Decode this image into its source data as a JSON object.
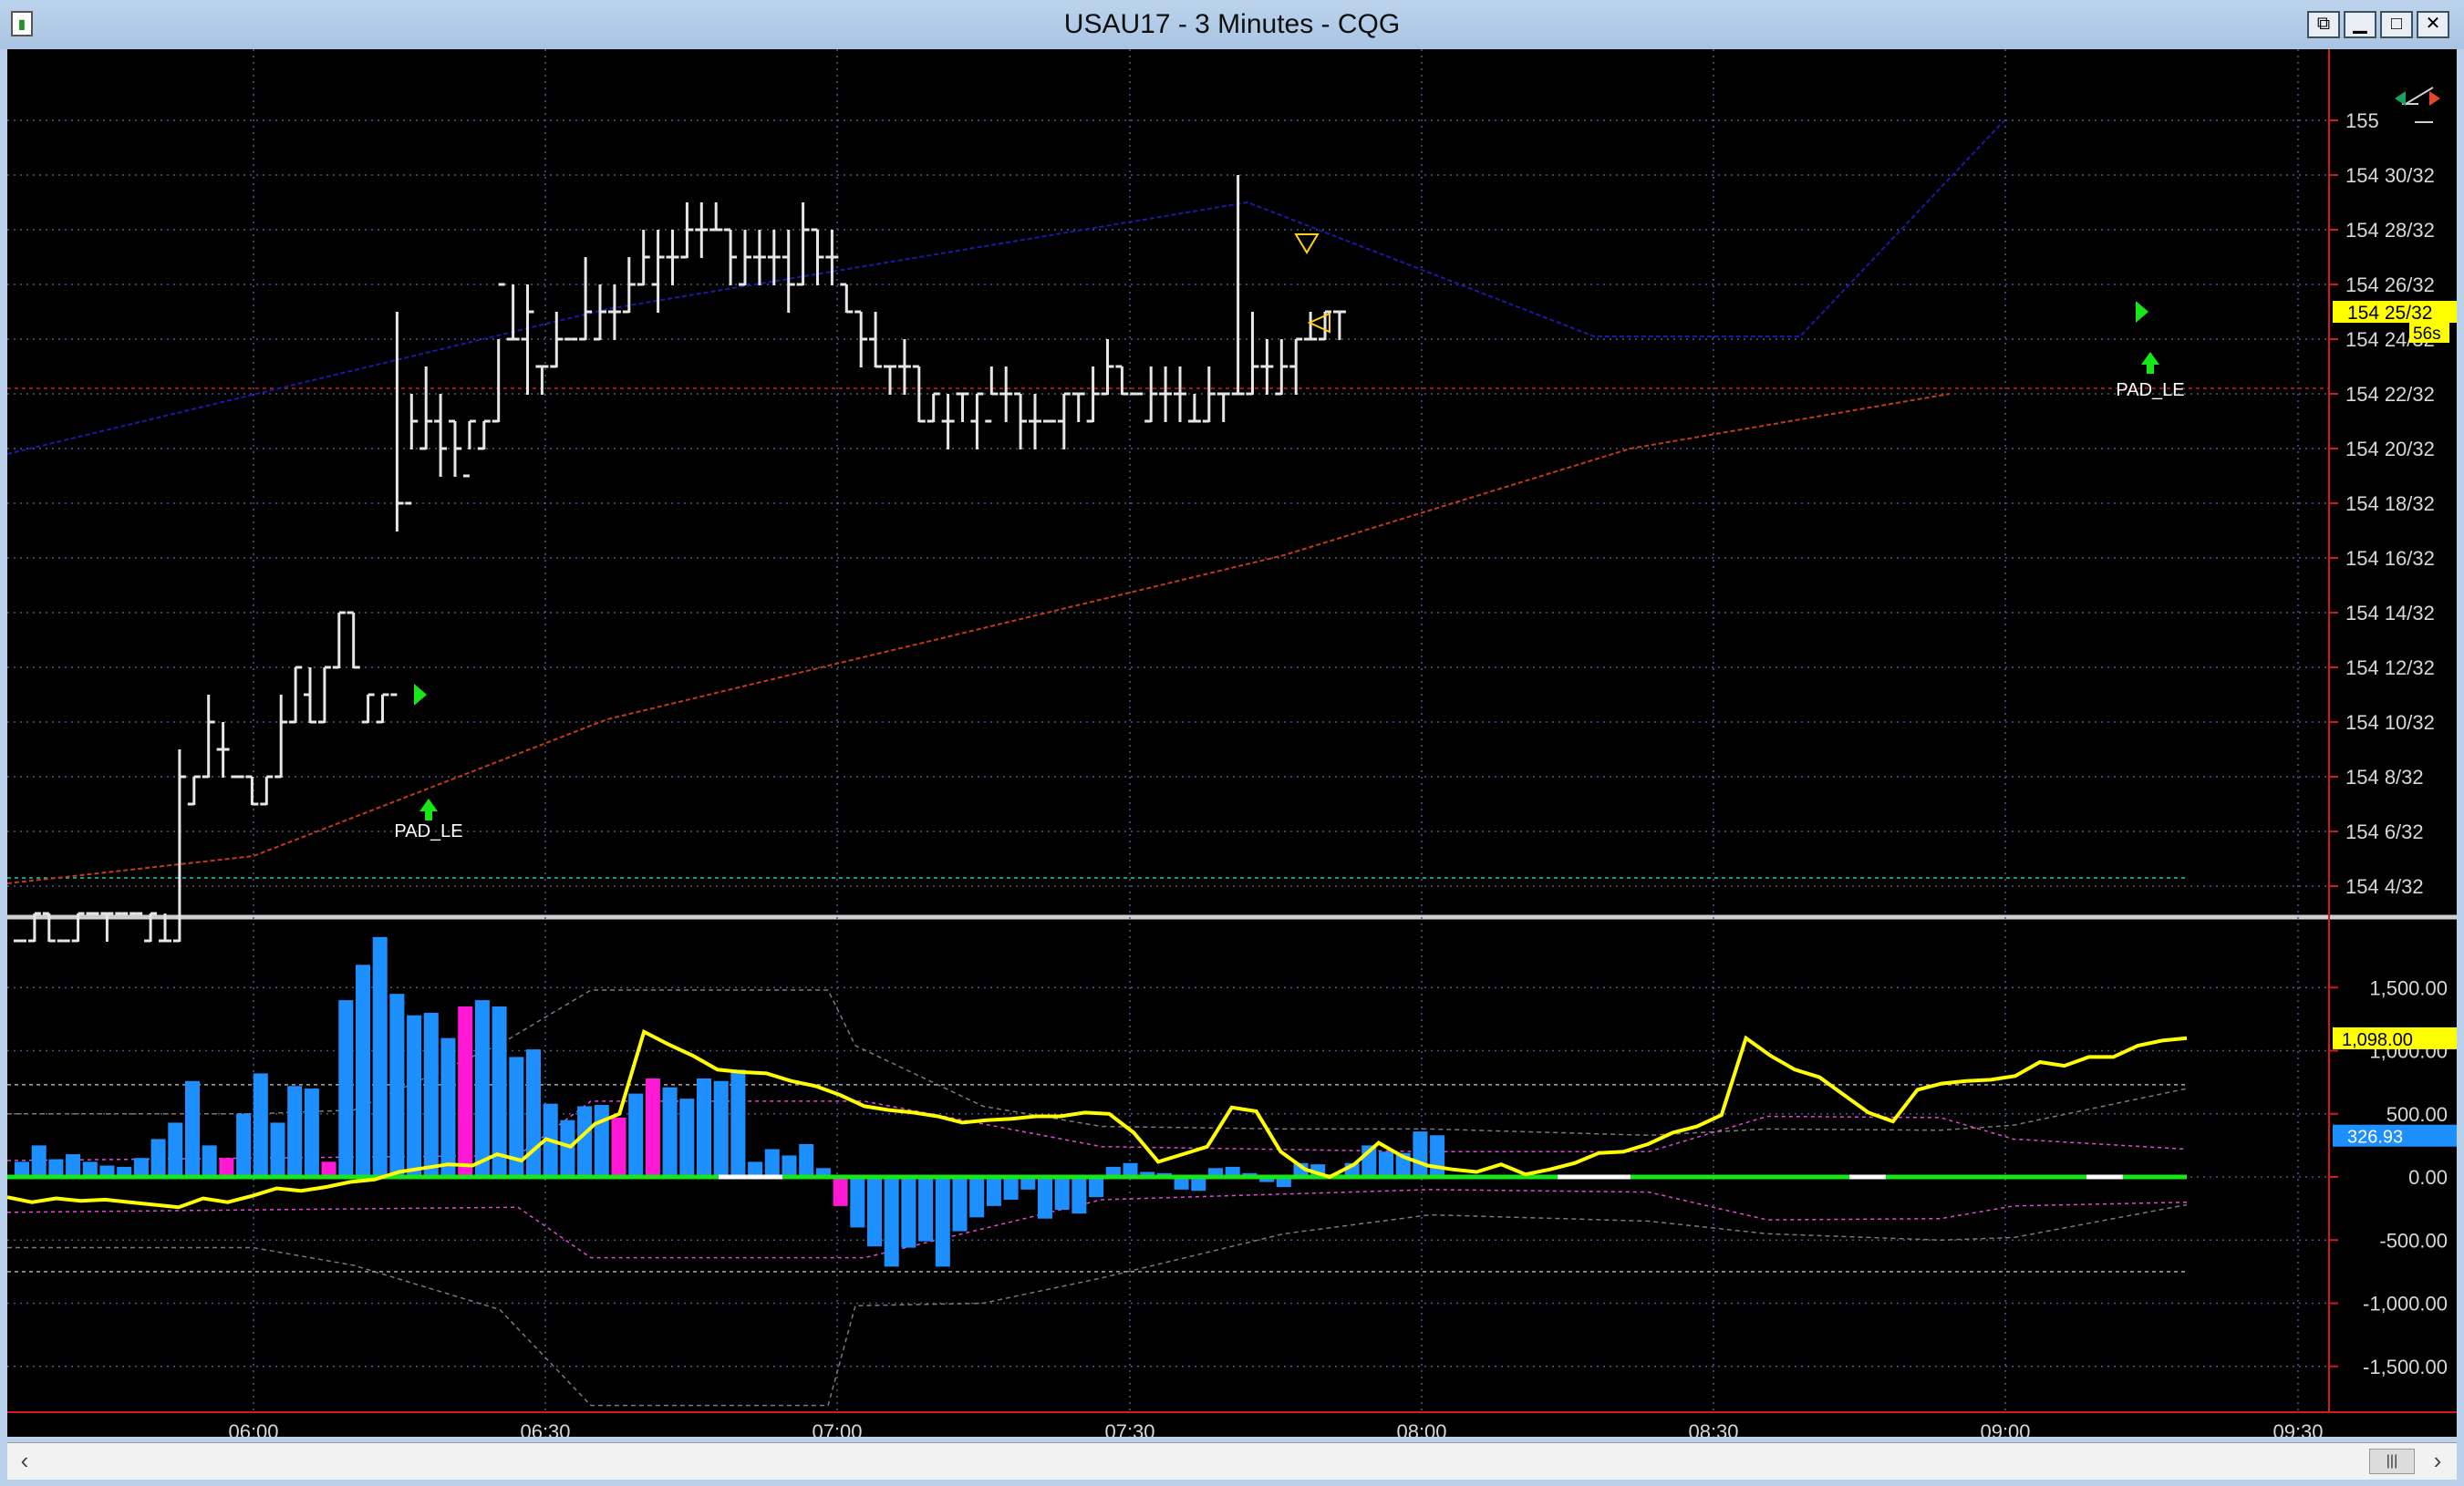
{
  "window": {
    "title": "USAU17 - 3 Minutes - CQG",
    "buttons": [
      "restore-icon",
      "minimize-icon",
      "maximize-icon",
      "close-icon"
    ]
  },
  "price_axis": {
    "labels": [
      "155",
      "154 30/32",
      "154 28/32",
      "154 26/32",
      "154 24/32",
      "154 22/32",
      "154 20/32",
      "154 18/32",
      "154 16/32",
      "154 14/32",
      "154 12/32",
      "154 10/32",
      "154 8/32",
      "154 6/32",
      "154 4/32"
    ],
    "current_price": "154 25/32",
    "countdown": "56s"
  },
  "indicator_axis": {
    "labels": [
      "1,500.00",
      "1,000.00",
      "500.00",
      "0.00",
      "-500.00",
      "-1,000.00",
      "-1,500.00"
    ],
    "line_value": "1,098.00",
    "hist_value": "326.93"
  },
  "time_axis": {
    "labels": [
      "06:00",
      "06:30",
      "07:00",
      "07:30",
      "08:00",
      "08:30",
      "09:00",
      "09:30"
    ]
  },
  "signals": {
    "long_entry_1": "PAD_LE",
    "long_entry_2": "PAD_LE"
  },
  "colors": {
    "background": "#000000",
    "bars": "#e6e6e6",
    "histogram_blue": "#1e8fff",
    "histogram_magenta": "#ff19d4",
    "oscillator_line": "#ffff00",
    "upper_band": "#1a1aa8",
    "lower_band": "#c23a1a",
    "price_tag": "#ffff00",
    "grid_red": "#d11a1a",
    "entry_arrow": "#19e619"
  },
  "chart_data": {
    "type": "bar",
    "title": "",
    "bars_ticks_32nds": [
      [
        2,
        2,
        2,
        2
      ],
      [
        2,
        3,
        2,
        3
      ],
      [
        3,
        3,
        2,
        2
      ],
      [
        2,
        2,
        2,
        2
      ],
      [
        2,
        3,
        2,
        3
      ],
      [
        3,
        3,
        3,
        3
      ],
      [
        3,
        3,
        2,
        3
      ],
      [
        3,
        3,
        3,
        3
      ],
      [
        3,
        3,
        3,
        3
      ],
      [
        2,
        3,
        2,
        3
      ],
      [
        2,
        3,
        2,
        2
      ],
      [
        2,
        9,
        2,
        8
      ],
      [
        7,
        8,
        7,
        8
      ],
      [
        8,
        11,
        8,
        10
      ],
      [
        9,
        10,
        8,
        9
      ],
      [
        8,
        8,
        8,
        8
      ],
      [
        8,
        8,
        7,
        7
      ],
      [
        7,
        8,
        7,
        8
      ],
      [
        8,
        11,
        8,
        10
      ],
      [
        10,
        12,
        10,
        12
      ],
      [
        11,
        12,
        10,
        10
      ],
      [
        10,
        12,
        10,
        12
      ],
      [
        12,
        14,
        12,
        14
      ],
      [
        14,
        14,
        12,
        12
      ],
      [
        10,
        11,
        10,
        11
      ],
      [
        10,
        11,
        10,
        11
      ],
      [
        11,
        25,
        17,
        18
      ],
      [
        18,
        22,
        20,
        21
      ],
      [
        20,
        23,
        20,
        21
      ],
      [
        21,
        22,
        19,
        20
      ],
      [
        21,
        21,
        19,
        20
      ],
      [
        19,
        21,
        20,
        21
      ],
      [
        20,
        21,
        20,
        21
      ],
      [
        21,
        24,
        21,
        26
      ],
      [
        24,
        26,
        24,
        24
      ],
      [
        24,
        26,
        22,
        25
      ],
      [
        23,
        23,
        22,
        23
      ],
      [
        23,
        25,
        23,
        24
      ],
      [
        24,
        24,
        24,
        24
      ],
      [
        24,
        27,
        24,
        25
      ],
      [
        24,
        26,
        24,
        25
      ],
      [
        25,
        26,
        24,
        25
      ],
      [
        25,
        27,
        25,
        26
      ],
      [
        26,
        28,
        26,
        27
      ],
      [
        26,
        28,
        25,
        27
      ],
      [
        27,
        28,
        26,
        27
      ],
      [
        27,
        29,
        27,
        28
      ],
      [
        28,
        29,
        27,
        28
      ],
      [
        28,
        29,
        28,
        28
      ],
      [
        28,
        28,
        26,
        27
      ],
      [
        26,
        28,
        26,
        27
      ],
      [
        27,
        28,
        26,
        27
      ],
      [
        27,
        28,
        26,
        27
      ],
      [
        27,
        28,
        25,
        26
      ],
      [
        26,
        29,
        26,
        28
      ],
      [
        28,
        28,
        26,
        27
      ],
      [
        27,
        28,
        26,
        27
      ],
      [
        26,
        26,
        25,
        25
      ],
      [
        25,
        25,
        23,
        24
      ],
      [
        24,
        25,
        23,
        23
      ],
      [
        23,
        23,
        22,
        23
      ],
      [
        23,
        24,
        22,
        23
      ],
      [
        23,
        23,
        21,
        21
      ],
      [
        21,
        22,
        21,
        22
      ],
      [
        21,
        22,
        20,
        21
      ],
      [
        22,
        22,
        21,
        22
      ],
      [
        21,
        22,
        20,
        22
      ],
      [
        21,
        23,
        22,
        22
      ],
      [
        22,
        23,
        21,
        22
      ],
      [
        22,
        22,
        20,
        21
      ],
      [
        21,
        22,
        20,
        21
      ],
      [
        21,
        21,
        21,
        21
      ],
      [
        21,
        22,
        20,
        22
      ],
      [
        22,
        22,
        21,
        22
      ],
      [
        21,
        23,
        21,
        22
      ],
      [
        22,
        24,
        22,
        23
      ],
      [
        23,
        23,
        22,
        22
      ],
      [
        22,
        22,
        22,
        22
      ],
      [
        21,
        23,
        21,
        22
      ],
      [
        22,
        23,
        21,
        22
      ],
      [
        22,
        23,
        21,
        22
      ],
      [
        21,
        22,
        21,
        21
      ],
      [
        21,
        23,
        21,
        22
      ],
      [
        22,
        22,
        21,
        22
      ],
      [
        22,
        30,
        22,
        22
      ],
      [
        22,
        25,
        22,
        23
      ],
      [
        23,
        24,
        22,
        23
      ],
      [
        22,
        24,
        22,
        23
      ],
      [
        23,
        24,
        22,
        24
      ],
      [
        24,
        25,
        24,
        24
      ],
      [
        24,
        25,
        24,
        25
      ],
      [
        25,
        25,
        24,
        25
      ]
    ],
    "histogram": [
      120,
      250,
      140,
      180,
      120,
      90,
      80,
      150,
      300,
      430,
      760,
      250,
      150,
      500,
      820,
      430,
      720,
      700,
      120,
      1400,
      1680,
      1900,
      1450,
      1280,
      1300,
      1100,
      1350,
      1400,
      1350,
      950,
      1010,
      580,
      450,
      560,
      570,
      470,
      660,
      780,
      710,
      620,
      780,
      760,
      850,
      120,
      220,
      170,
      260,
      70,
      -230,
      -400,
      -550,
      -710,
      -560,
      -510,
      -710,
      -430,
      -320,
      -230,
      -180,
      -100,
      -330,
      -260,
      -290,
      -160,
      80,
      110,
      40,
      30,
      -100,
      -110,
      70,
      80,
      30,
      -40,
      -80,
      110,
      100,
      20,
      110,
      250,
      200,
      190,
      360,
      330
    ],
    "oscillator": [
      -160,
      -200,
      -170,
      -190,
      -180,
      -200,
      -220,
      -240,
      -170,
      -200,
      -150,
      -90,
      -110,
      -80,
      -40,
      -20,
      40,
      70,
      100,
      90,
      180,
      130,
      300,
      240,
      420,
      500,
      1150,
      1050,
      960,
      850,
      830,
      820,
      760,
      720,
      650,
      560,
      530,
      510,
      480,
      430,
      450,
      460,
      480,
      480,
      510,
      500,
      350,
      120,
      180,
      240,
      550,
      520,
      200,
      60,
      0,
      100,
      270,
      160,
      90,
      60,
      40,
      100,
      20,
      60,
      110,
      190,
      200,
      260,
      350,
      400,
      490,
      1100,
      960,
      850,
      790,
      650,
      510,
      440,
      690,
      740,
      760,
      770,
      800,
      910,
      880,
      950,
      950,
      1040,
      1080,
      1100
    ]
  }
}
